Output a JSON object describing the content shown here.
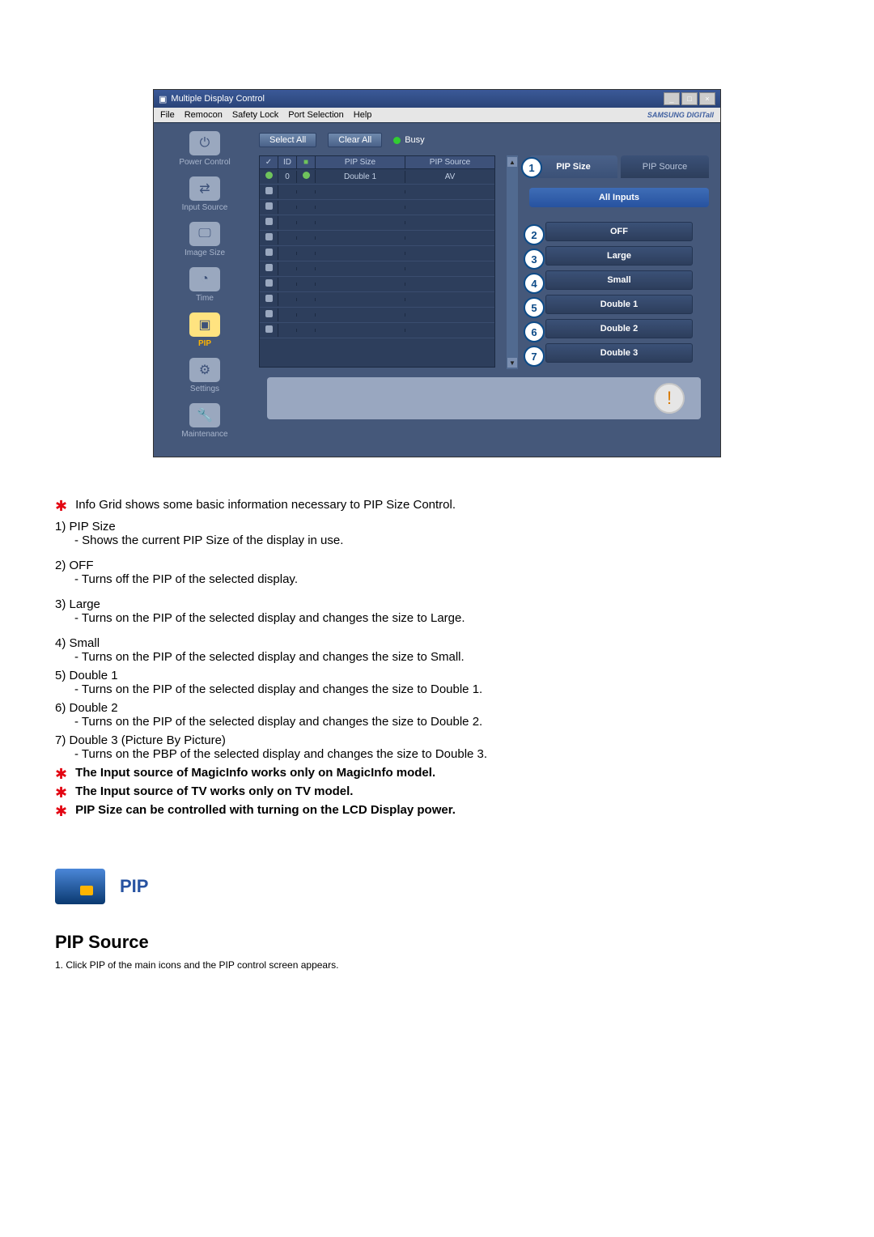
{
  "window": {
    "title": "Multiple Display Control",
    "menu": [
      "File",
      "Remocon",
      "Safety Lock",
      "Port Selection",
      "Help"
    ],
    "logo": "SAMSUNG DIGITall"
  },
  "sidebar": {
    "items": [
      {
        "label": "Power Control"
      },
      {
        "label": "Input Source"
      },
      {
        "label": "Image Size"
      },
      {
        "label": "Time"
      },
      {
        "label": "PIP"
      },
      {
        "label": "Settings"
      },
      {
        "label": "Maintenance"
      }
    ]
  },
  "toolbar": {
    "select_all": "Select All",
    "clear_all": "Clear All",
    "busy": "Busy"
  },
  "grid": {
    "headers": {
      "check": "✓",
      "id": "ID",
      "status": "■",
      "size": "PIP Size",
      "source": "PIP Source"
    },
    "row0": {
      "id": "0",
      "size": "Double 1",
      "source": "AV"
    }
  },
  "tabs": {
    "pip_size": "PIP Size",
    "pip_source": "PIP Source"
  },
  "all_inputs": "All Inputs",
  "options": [
    "OFF",
    "Large",
    "Small",
    "Double 1",
    "Double 2",
    "Double 3"
  ],
  "badges": [
    "1",
    "2",
    "3",
    "4",
    "5",
    "6",
    "7"
  ],
  "doc": {
    "intro": "Info Grid shows some basic information necessary to PIP Size Control.",
    "items": [
      {
        "n": "1)",
        "t": "PIP Size",
        "d": "- Shows the current PIP Size of the display in use."
      },
      {
        "n": "2)",
        "t": "OFF",
        "d": "- Turns off the PIP of the selected display."
      },
      {
        "n": "3)",
        "t": "Large",
        "d": "- Turns on the PIP of the selected display and changes the size to Large."
      },
      {
        "n": "4)",
        "t": "Small",
        "d": "- Turns on the PIP of the selected display and changes the size to Small."
      },
      {
        "n": "5)",
        "t": "Double 1",
        "d": "- Turns on the PIP of the selected display and changes the size to Double 1."
      },
      {
        "n": "6)",
        "t": "Double 2",
        "d": "- Turns on the PIP of the selected display and changes the size to Double 2."
      },
      {
        "n": "7)",
        "t": "Double 3 (Picture By Picture)",
        "d": "- Turns on the PBP of the selected display and changes the size to Double 3."
      }
    ],
    "notes": [
      "The Input source of MagicInfo works only on MagicInfo model.",
      "The Input source of TV works only on TV model.",
      "PIP Size can be controlled with turning on the LCD Display power."
    ]
  },
  "section": {
    "pip_title": "PIP",
    "sub_title": "PIP Source",
    "step1": "1.  Click PIP of the main icons and the PIP control screen appears."
  }
}
